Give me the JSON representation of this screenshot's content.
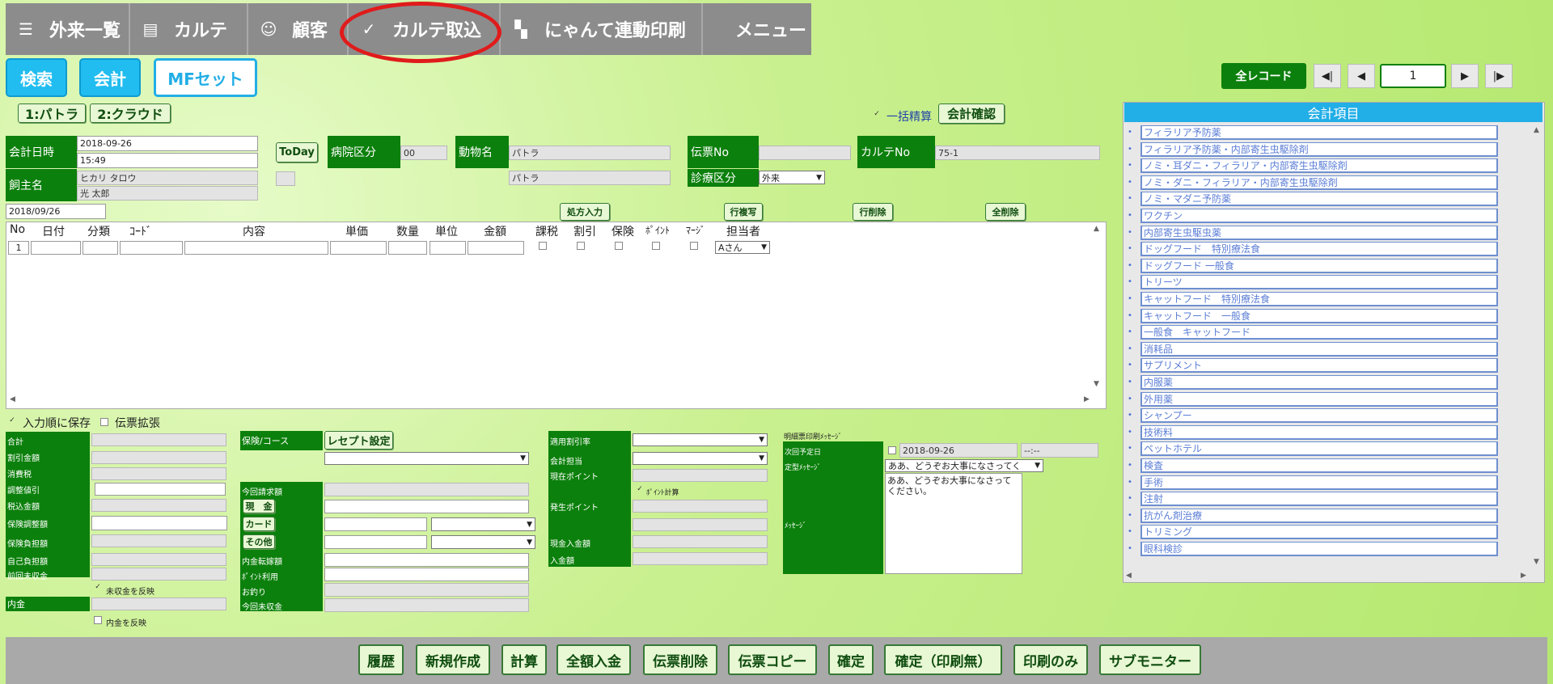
{
  "nav": [
    {
      "icon": "☰",
      "label": "外来一覧"
    },
    {
      "icon": "▤",
      "label": "カルテ"
    },
    {
      "icon": "☺",
      "label": "顧客"
    },
    {
      "icon": "✓",
      "label": "カルテ取込"
    },
    {
      "icon": "▚",
      "label": "にゃんて連動印刷"
    },
    {
      "icon": "",
      "label": "メニュー"
    }
  ],
  "actions": {
    "search": "検索",
    "accounting": "会計",
    "mfset": "MFセット"
  },
  "tabs": {
    "tab1": "1:パトラ",
    "tab2": "2:クラウド"
  },
  "pager": {
    "all": "全レコード",
    "first": "◀|",
    "prev": "◀",
    "page": "1",
    "next": "▶",
    "last": "|▶"
  },
  "bulk": {
    "label": "一括精算",
    "confirm": "会計確認"
  },
  "form": {
    "date_label": "会計日時",
    "date": "2018-09-26",
    "time": "15:49",
    "owner_label": "飼主名",
    "owner_kana": "ヒカリ タロウ",
    "owner_name": "光 太郎",
    "today": "ToDay",
    "hospital_label": "病院区分",
    "hospital": "00",
    "animal_label": "動物名",
    "animal1": "パトラ",
    "animal2": "パトラ",
    "slip_label": "伝票No",
    "slip": "",
    "karte_label": "カルテNo",
    "karte": "75-1",
    "visit_label": "診療区分",
    "visit": "外来",
    "date2": "2018/09/26"
  },
  "gridbtns": {
    "rx": "処方入力",
    "copy": "行複写",
    "del": "行削除",
    "delall": "全削除"
  },
  "grid": {
    "headers": [
      "No",
      "日付",
      "分類",
      "ｺｰﾄﾞ",
      "内容",
      "単価",
      "数量",
      "単位",
      "金額",
      "課税",
      "割引",
      "保険",
      "ﾎﾟｲﾝﾄ",
      "ﾏｰｼﾞ",
      "担当者"
    ],
    "row": {
      "no": "1",
      "staff": "Aさん"
    }
  },
  "options": {
    "order": "入力順に保存",
    "expand": "伝票拡張"
  },
  "summary": {
    "labels": [
      "合計",
      "割引金額",
      "消費税",
      "調整値引",
      "税込金額",
      "保険調整額",
      "保険負担額",
      "自己負担額",
      "前回未収金"
    ],
    "uncollected": "未収金を反映",
    "deposit": "内金",
    "deposit_chk": "内金を反映"
  },
  "payment": {
    "course": "保険/コース",
    "receipt": "レセプト設定",
    "bill": "今回請求額",
    "cash": "現　金",
    "card": "カード",
    "other": "その他",
    "transfer": "内金転嫁額",
    "point": "ﾎﾟｲﾝﾄ利用",
    "change": "お釣り",
    "unpaid": "今回未収金"
  },
  "rates": {
    "discount": "適用割引率",
    "staff": "会計担当",
    "current": "現在ポイント",
    "pointcalc": "ﾎﾟｲﾝﾄ計算",
    "earned": "発生ポイント",
    "cashin": "現金入金額",
    "paid": "入金額"
  },
  "message": {
    "title": "明細票印刷ﾒｯｾｰｼﾞ",
    "next": "次回予定日",
    "next_date": "2018-09-26",
    "next_time": "--:--",
    "fixed": "定型ﾒｯｾｰｼﾞ",
    "fixed_sel": "ああ、どうぞお大事になさってく",
    "msg": "ﾒｯｾｰｼﾞ",
    "msg_text": "ああ、どうぞお大事になさってください。"
  },
  "panel": {
    "title": "会計項目",
    "items": [
      "フィラリア予防薬",
      "フィラリア予防薬・内部寄生虫駆除剤",
      "ノミ・耳ダニ・フィラリア・内部寄生虫駆除剤",
      "ノミ・ダニ・フィラリア・内部寄生虫駆除剤",
      "ノミ・マダニ予防薬",
      "ワクチン",
      "内部寄生虫駆虫薬",
      "ドッグフード　特別療法食",
      "ドッグフード 一般食",
      "トリーツ",
      "キャットフード　特別療法食",
      "キャットフード　一般食",
      "一般食　キャットフード",
      "消耗品",
      "サプリメント",
      "内服薬",
      "外用薬",
      "シャンプー",
      "技術料",
      "ペットホテル",
      "検査",
      "手術",
      "注射",
      "抗がん剤治療",
      "トリミング",
      "眼科検診"
    ]
  },
  "bottom": [
    "履歴",
    "新規作成",
    "計算",
    "全額入金",
    "伝票削除",
    "伝票コピー",
    "確定",
    "確定（印刷無）",
    "印刷のみ",
    "サブモニター"
  ],
  "colors": {
    "header_green": "#0c800c",
    "accent_blue": "#22aee6",
    "nav_gray": "#8c8c8c",
    "highlight_red": "#e01b1b"
  }
}
